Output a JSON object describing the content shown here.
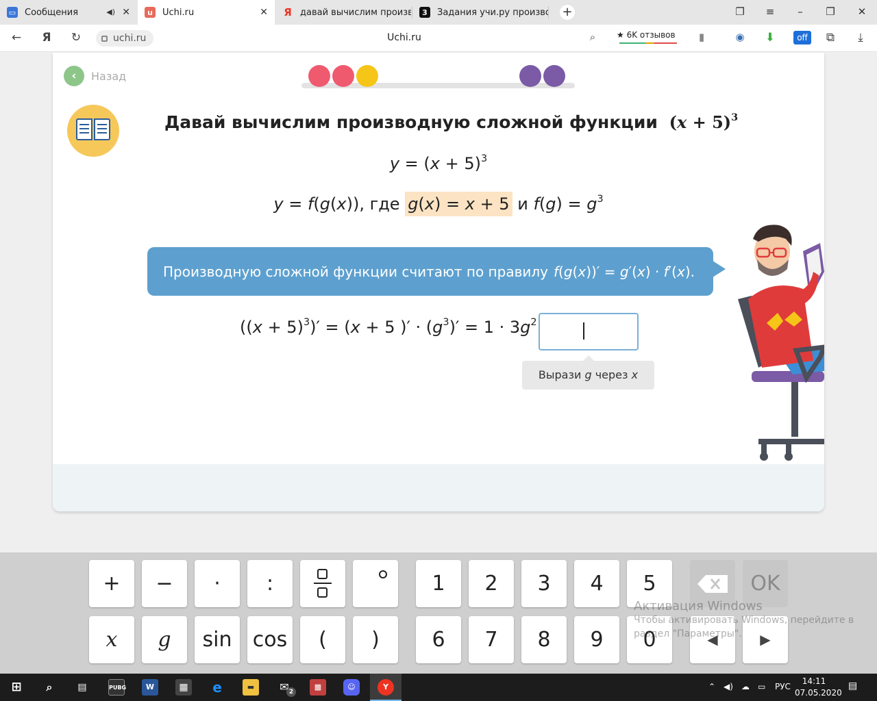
{
  "browser": {
    "tabs": [
      {
        "label": "Сообщения"
      },
      {
        "label": "Uchi.ru"
      },
      {
        "label": "давай вычислим произво"
      },
      {
        "label": "Задания учи.ру производ"
      }
    ],
    "url": "uchi.ru",
    "page_title": "Uchi.ru",
    "reviews": "★ 6K отзывов"
  },
  "lesson": {
    "back_label": "Назад",
    "progress": {
      "colors": [
        "#ef5a6f",
        "#ef5a6f",
        "#f5c518",
        "#7b5aa6",
        "#7b5aa6"
      ],
      "filled": 5
    },
    "title": "Давай вычислим производную сложной функции",
    "title_formula": {
      "open": "(",
      "var": "x",
      "rest": " + 5)",
      "pow": "3"
    },
    "line1": {
      "y": "y",
      "eq": " = (",
      "x": "x",
      "rest": " + 5)",
      "pow": "3"
    },
    "line2": {
      "y": "y",
      "eq1": " = ",
      "f": "f",
      "p1": "(",
      "g": "g",
      "p2": "(",
      "x": "x",
      "p3": ")),",
      "where": " где ",
      "hl_g": "g",
      "hl_p1": "(",
      "hl_x": "x",
      "hl_p2": ") = ",
      "hl_x2": "x",
      "hl_rest": " + 5",
      "and": " и ",
      "f2": "f",
      "p4": "(",
      "g2": "g",
      "p5": ") = ",
      "g3": "g",
      "pow": "3"
    },
    "rule": {
      "text": "Производную сложной функции считают по правилу",
      "f": "f",
      "p1": "(",
      "g": "g",
      "p2": "(",
      "x": "x",
      "p3": "))′ = ",
      "g2": "g",
      "p4": "′(",
      "x2": "x",
      "p5": ") · ",
      "f2": "f",
      "p6": "′(",
      "x3": "x",
      "p7": ")."
    },
    "equation": {
      "a": "((",
      "x": "x",
      "b": " + 5)",
      "pow1": "3",
      "c": ")′ = (",
      "x2": "x",
      "d": " + 5 )′ · (",
      "g": "g",
      "pow2": "3",
      "e": ")′ = 1  ·  3",
      "g2": "g",
      "pow3": "2",
      "f": " ="
    },
    "hint": {
      "pre": "Вырази ",
      "g": "g",
      "mid": " через ",
      "x": "x"
    }
  },
  "keyboard": {
    "row1_ops": [
      "+",
      "−",
      "·",
      ":"
    ],
    "row1_digits": [
      "1",
      "2",
      "3",
      "4",
      "5"
    ],
    "row2_ops": [
      "x",
      "g",
      "sin",
      "cos",
      "(",
      ")"
    ],
    "row2_digits": [
      "6",
      "7",
      "8",
      "9",
      "0"
    ],
    "ok": "OK",
    "left_arrow": "◀",
    "right_arrow": "▶"
  },
  "watermark": {
    "title": "Активация Windows",
    "line1": "Чтобы активировать Windows, перейдите в",
    "line2": "раздел \"Параметры\"."
  },
  "taskbar": {
    "mail_badge": "2",
    "lang": "РУС",
    "time": "14:11",
    "date": "07.05.2020"
  }
}
